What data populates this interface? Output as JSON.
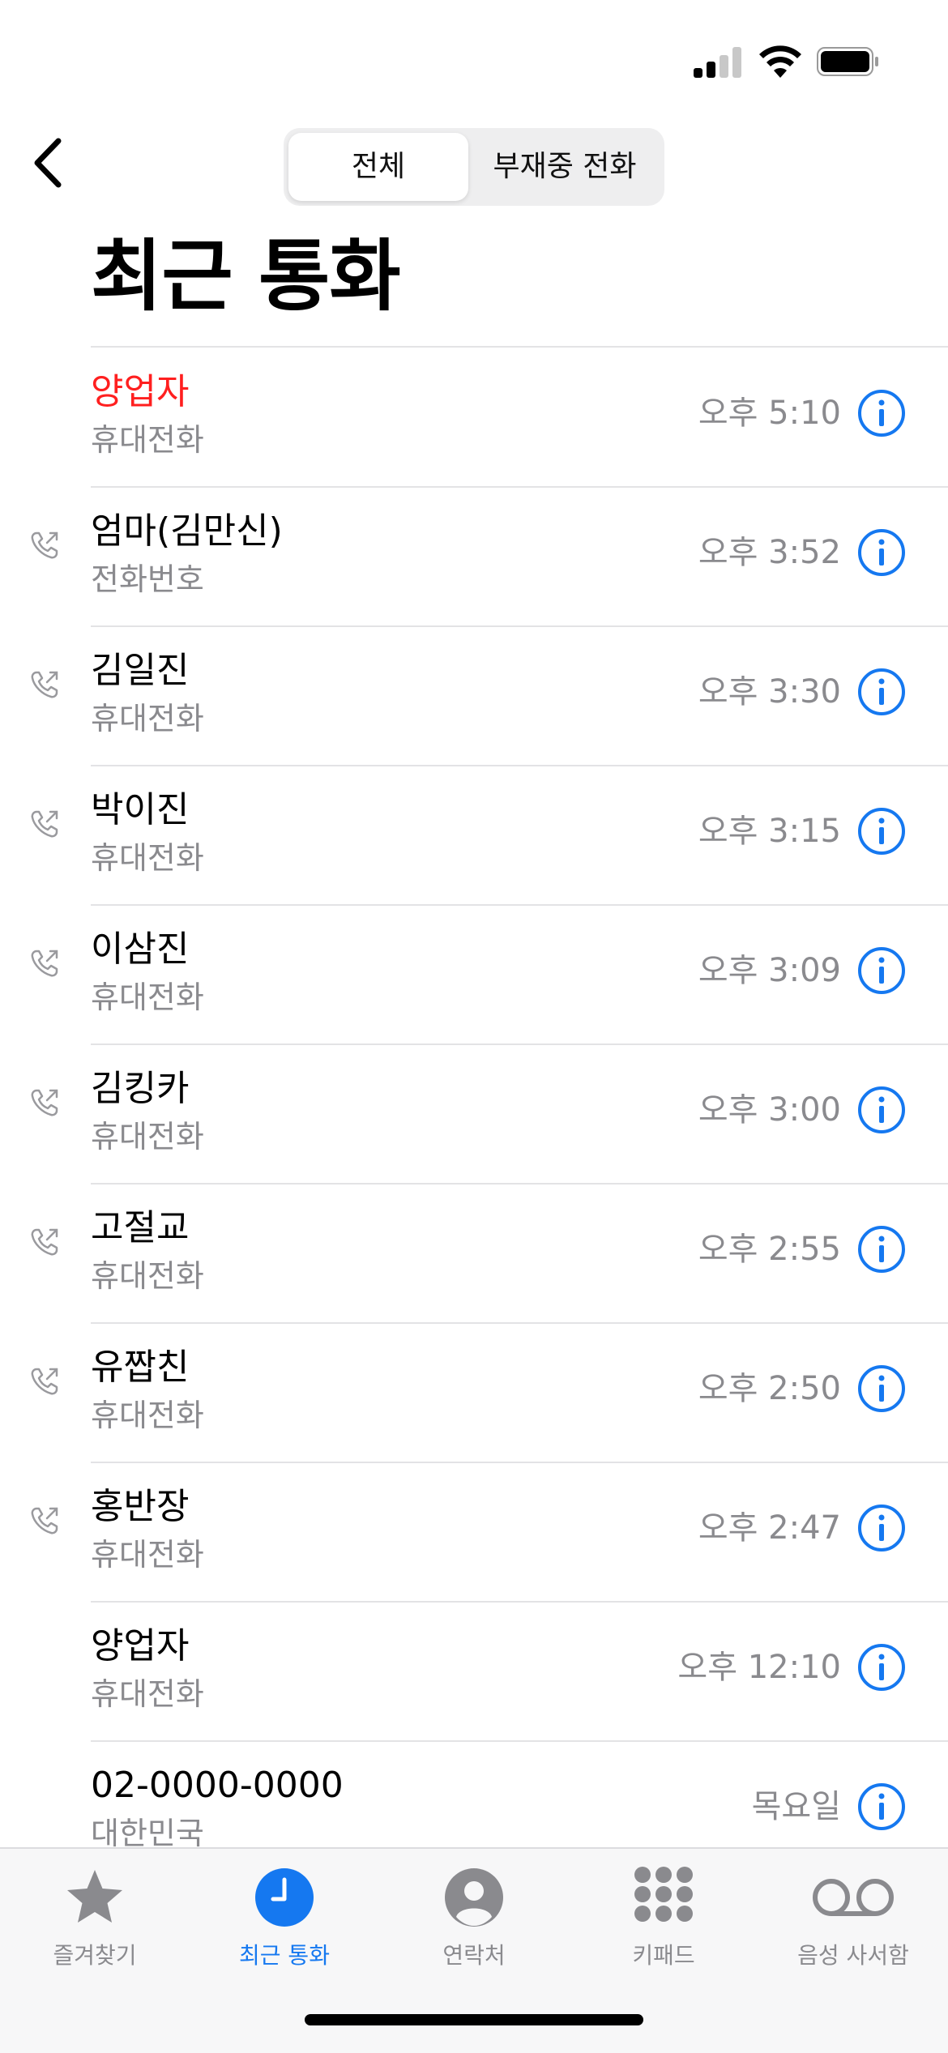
{
  "status_bar": {
    "signal_bars": 2,
    "signal_total": 4
  },
  "nav": {
    "segments": [
      {
        "label": "전체",
        "selected": true
      },
      {
        "label": "부재중 전화",
        "selected": false
      }
    ],
    "title": "최근 통화"
  },
  "calls": [
    {
      "name": "양업자",
      "type": "휴대전화",
      "time": "오후 5:10",
      "missed": true,
      "outgoing": false
    },
    {
      "name": "엄마(김만신)",
      "type": "전화번호",
      "time": "오후 3:52",
      "missed": false,
      "outgoing": true
    },
    {
      "name": "김일진",
      "type": "휴대전화",
      "time": "오후 3:30",
      "missed": false,
      "outgoing": true
    },
    {
      "name": "박이진",
      "type": "휴대전화",
      "time": "오후 3:15",
      "missed": false,
      "outgoing": true
    },
    {
      "name": "이삼진",
      "type": "휴대전화",
      "time": "오후 3:09",
      "missed": false,
      "outgoing": true
    },
    {
      "name": "김킹카",
      "type": "휴대전화",
      "time": "오후 3:00",
      "missed": false,
      "outgoing": true
    },
    {
      "name": "고절교",
      "type": "휴대전화",
      "time": "오후 2:55",
      "missed": false,
      "outgoing": true
    },
    {
      "name": "유짭친",
      "type": "휴대전화",
      "time": "오후 2:50",
      "missed": false,
      "outgoing": true
    },
    {
      "name": "홍반장",
      "type": "휴대전화",
      "time": "오후 2:47",
      "missed": false,
      "outgoing": true
    },
    {
      "name": "양업자",
      "type": "휴대전화",
      "time": "오후 12:10",
      "missed": false,
      "outgoing": false
    },
    {
      "name": "02-0000-0000",
      "type": "대한민국",
      "time": "목요일",
      "missed": false,
      "outgoing": false
    }
  ],
  "tabbar": {
    "tabs": [
      {
        "label": "즐겨찾기",
        "icon": "star-icon",
        "active": false
      },
      {
        "label": "최근 통화",
        "icon": "clock-icon",
        "active": true
      },
      {
        "label": "연락처",
        "icon": "person-icon",
        "active": false
      },
      {
        "label": "키패드",
        "icon": "keypad-icon",
        "active": false
      },
      {
        "label": "음성 사서함",
        "icon": "voicemail-icon",
        "active": false
      }
    ]
  },
  "colors": {
    "accent": "#1578f0",
    "missed": "#ff1f1f",
    "secondary_text": "#8a8a8e"
  }
}
